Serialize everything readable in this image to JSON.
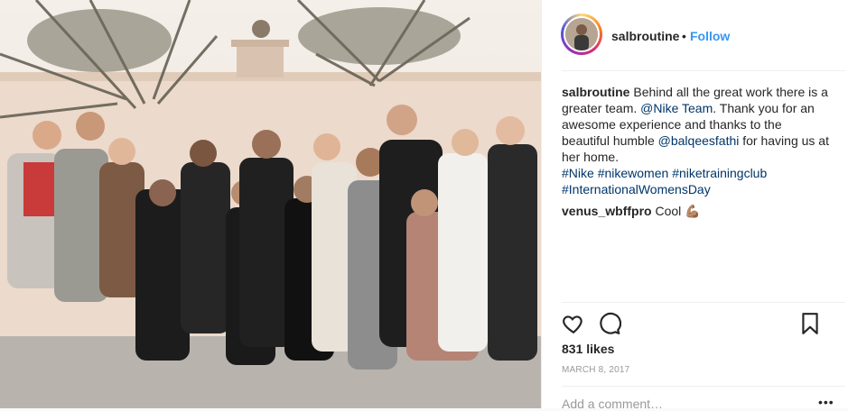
{
  "post": {
    "username": "salbroutine",
    "separator": "•",
    "follow_label": "Follow",
    "caption": {
      "username": "salbroutine",
      "text_1": "Behind all the great work there is a greater team.",
      "mention_1": "@Nike Team",
      "text_2": ". Thank you for an awesome experience and thanks to the beautiful humble",
      "mention_2": "@balqeesfathi",
      "text_3": "for having us at her home.",
      "hashtag_1": "#Nike",
      "hashtag_2": "#nikewomen",
      "hashtag_3": "#niketrainingclub",
      "hashtag_4": "#InternationalWomensDay"
    },
    "comment": {
      "username": "venus_wbffpro",
      "text": "Cool",
      "emoji": "💪🏽"
    },
    "likes": "831 likes",
    "date": "MARCH 8, 2017",
    "add_comment_placeholder": "Add a comment…",
    "more_label": "•••"
  },
  "icons": [
    "heart-icon",
    "comment-icon",
    "bookmark-icon"
  ]
}
